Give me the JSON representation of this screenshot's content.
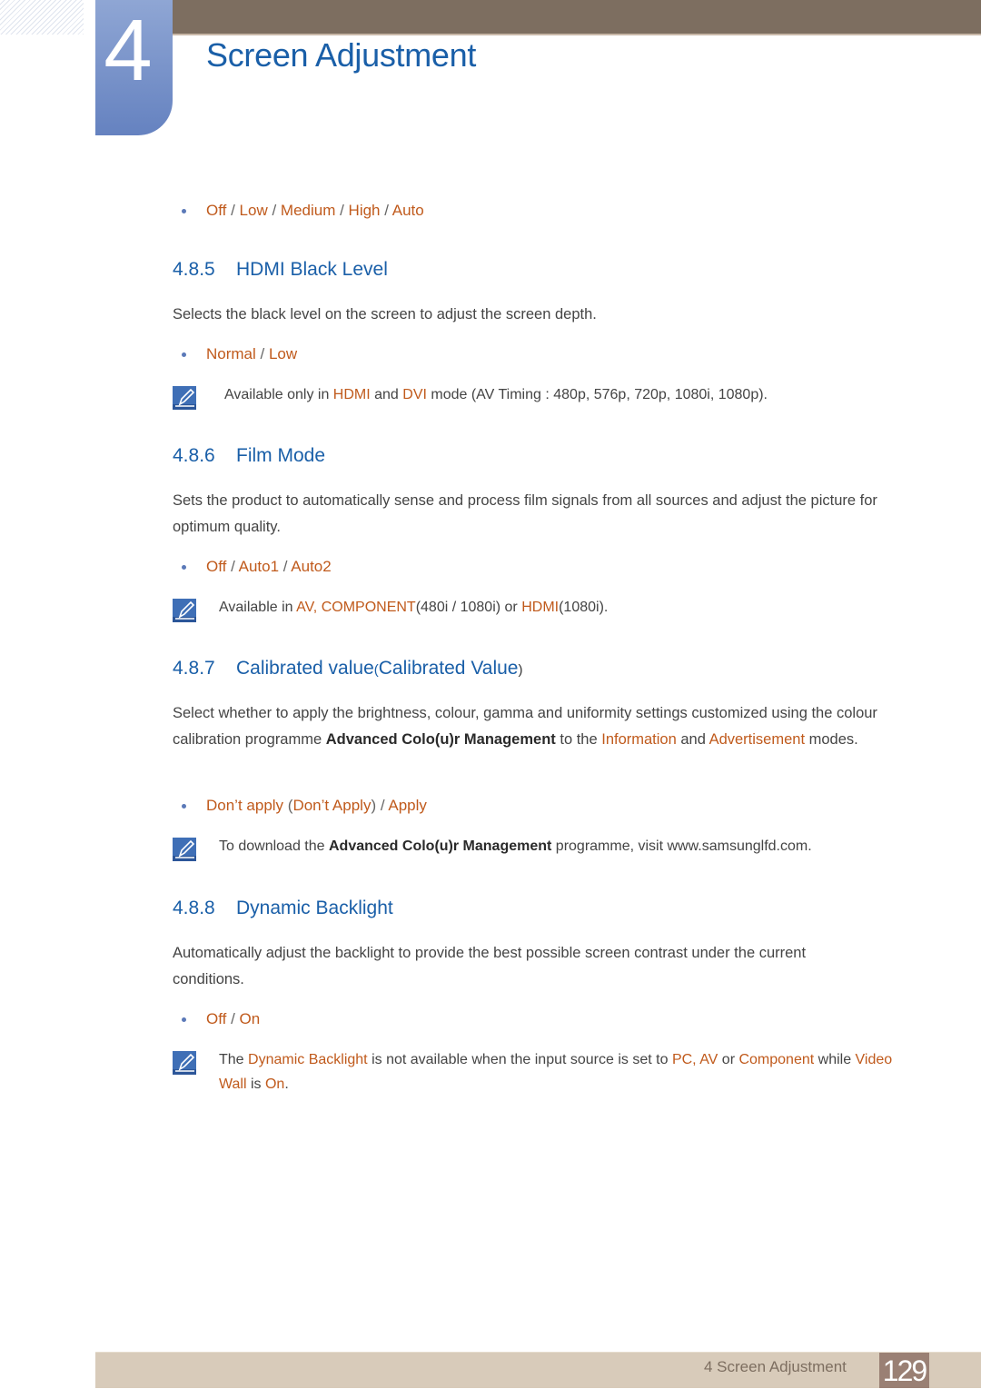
{
  "header": {
    "chapter_number": "4",
    "chapter_title": "Screen Adjustment"
  },
  "top_options": {
    "parts": [
      {
        "text": "Off",
        "hl": true
      },
      {
        "text": " / ",
        "hl": false
      },
      {
        "text": "Low",
        "hl": true
      },
      {
        "text": " / ",
        "hl": false
      },
      {
        "text": "Medium",
        "hl": true
      },
      {
        "text": " / ",
        "hl": false
      },
      {
        "text": "High",
        "hl": true
      },
      {
        "text": " / ",
        "hl": false
      },
      {
        "text": "Auto",
        "hl": true
      }
    ]
  },
  "sections": [
    {
      "number": "4.8.5",
      "title": "HDMI Black Level",
      "body": "Selects the black level on the screen to adjust the screen depth.",
      "options": [
        "Normal",
        " / ",
        "Low"
      ],
      "note": {
        "pre": "Available only in ",
        "hl1": "HDMI",
        "mid": " and ",
        "hl2": "DVI",
        "post": " mode (AV Timing : 480p, 576p, 720p, 1080i, 1080p)."
      }
    },
    {
      "number": "4.8.6",
      "title": "Film Mode",
      "body": "Sets the product to automatically sense and process film signals from all sources and adjust the picture for optimum quality.",
      "options": [
        "Off",
        " / ",
        "Auto1",
        " / ",
        "Auto2"
      ],
      "note": {
        "pre": "Available in ",
        "hl1": "AV",
        "sep": ", ",
        "hl2": "COMPONENT",
        "mid": "(480i / 1080i) or ",
        "hl3": "HDMI",
        "post": "(1080i)."
      }
    },
    {
      "number": "4.8.7",
      "title": "Calibrated value",
      "title_paren_open": "(",
      "title_alt": "Calibrated Value",
      "title_paren_close": ")",
      "body_pre": "Select whether to apply the brightness, colour, gamma and uniformity settings customized using the colour calibration programme ",
      "body_bold": "Advanced Colo(u)r Management",
      "body_mid": " to the ",
      "body_hl1": "Information",
      "body_and": " and ",
      "body_hl2": "Advertisement",
      "body_post": " modes.",
      "options": [
        "Don’t apply",
        " (",
        "Don’t Apply",
        ") / ",
        "Apply"
      ],
      "note": {
        "pre": "To download the ",
        "bold": "Advanced Colo(u)r Management",
        "post": " programme, visit www.samsunglfd.com."
      }
    },
    {
      "number": "4.8.8",
      "title": "Dynamic Backlight",
      "body": "Automatically adjust the backlight to provide the best possible screen contrast under the current conditions.",
      "options": [
        "Off",
        " / ",
        "On"
      ],
      "note": {
        "pre": "The ",
        "hl1": "Dynamic Backlight",
        "mid1": " is not available when the input source is set to ",
        "hl2": "PC",
        "sep": ", ",
        "hl3": "AV",
        "mid2": " or ",
        "hl4": "Component",
        "mid3": " while ",
        "hl5": "Video Wall",
        "mid4": " is ",
        "hl6": "On",
        "post": "."
      }
    }
  ],
  "footer": {
    "label": "4 Screen Adjustment",
    "page_number": "129"
  },
  "icons": {
    "note": "note-pencil-icon",
    "bullet": "bullet-dot-icon"
  },
  "colors": {
    "heading_blue": "#1a5fa8",
    "highlight_orange": "#c05a1c",
    "header_brown": "#7d6e60",
    "footer_tan": "#d8cbba",
    "page_badge": "#9a8074"
  }
}
